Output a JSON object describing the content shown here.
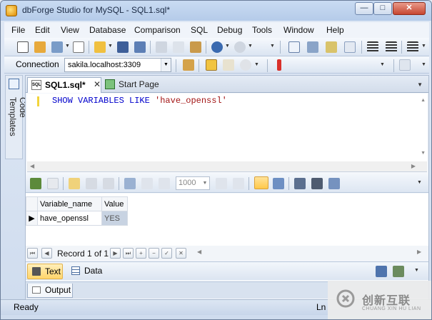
{
  "window": {
    "title": "dbForge Studio for MySQL - SQL1.sql*",
    "minimize_glyph": "—",
    "maximize_glyph": "□",
    "close_glyph": "✕"
  },
  "menu": {
    "items": [
      "File",
      "Edit",
      "View",
      "Database",
      "Comparison",
      "SQL",
      "Debug",
      "Tools",
      "Window",
      "Help"
    ]
  },
  "connection": {
    "label": "Connection",
    "value": "sakila.localhost:3309"
  },
  "side_panel": {
    "label": "Code Templates"
  },
  "tabs": {
    "active_label": "SQL1.sql*",
    "active_icon_text": "SQL",
    "close_glyph": "✕",
    "start_label": "Start Page"
  },
  "editor": {
    "keyword_text": "SHOW VARIABLES LIKE ",
    "string_text": "'have_openssl'"
  },
  "results_toolbar": {
    "page_size": "1000"
  },
  "grid": {
    "headers": [
      "Variable_name",
      "Value"
    ],
    "rows": [
      {
        "variable_name": "have_openssl",
        "value": "YES"
      }
    ]
  },
  "record_nav": {
    "text": "Record 1 of 1"
  },
  "view_switch": {
    "text_label": "Text",
    "data_label": "Data"
  },
  "output": {
    "label": "Output"
  },
  "status": {
    "ready": "Ready",
    "ln": "Ln"
  },
  "watermark": {
    "cn": "创新互联",
    "en": "CHUANG XIN HU LIAN"
  },
  "colors": {
    "accent": "#ffd56a",
    "selection": "#c8d3e2",
    "keyword": "#0000cc",
    "string": "#a31515"
  }
}
